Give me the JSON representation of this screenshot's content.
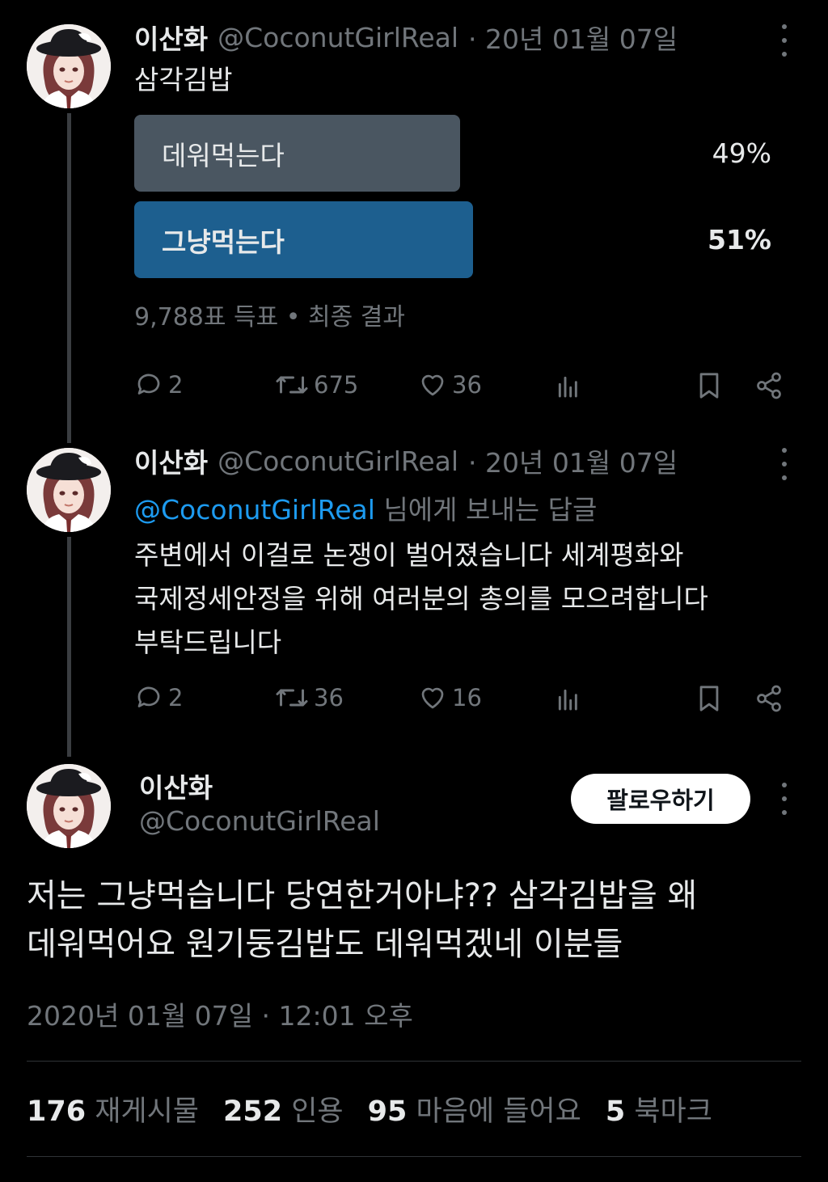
{
  "tweet1": {
    "name": "이산화",
    "handle": "@CoconutGirlReal",
    "date": "· 20년 01월 07일",
    "text": "삼각김밥",
    "poll": [
      {
        "label": "데워먹는다",
        "percent": "49%",
        "fraction": 0.49,
        "winner": false,
        "color": "#4a5661"
      },
      {
        "label": "그냥먹는다",
        "percent": "51%",
        "fraction": 0.51,
        "winner": true,
        "color": "#1d5f8f"
      }
    ],
    "poll_footer": "9,788표 득표 • 최종 결과",
    "actions": {
      "replies": "2",
      "reposts": "675",
      "likes": "36"
    }
  },
  "tweet2": {
    "name": "이산화",
    "handle": "@CoconutGirlReal",
    "date": "· 20년 01월 07일",
    "reply_to_handle": "@CoconutGirlReal",
    "reply_to_suffix": " 님에게 보내는 답글",
    "lines": [
      "주변에서 이걸로 논쟁이 벌어졌습니다 세계평화와",
      "국제정세안정을 위해 여러분의 총의를 모으려합니다",
      "부탁드립니다"
    ],
    "actions": {
      "replies": "2",
      "reposts": "36",
      "likes": "16"
    }
  },
  "main": {
    "name": "이산화",
    "handle": "@CoconutGirlReal",
    "follow_label": "팔로우하기",
    "lines": [
      "저는 그냥먹습니다 당연한거아냐?? 삼각김밥을 왜",
      "데워먹어요 원기둥김밥도 데워먹겠네 이분들"
    ],
    "timestamp": "2020년 01월 07일 · 12:01 오후",
    "stats": [
      {
        "count": "176",
        "label": "재게시물"
      },
      {
        "count": "252",
        "label": "인용"
      },
      {
        "count": "95",
        "label": "마음에 들어요"
      },
      {
        "count": "5",
        "label": "북마크"
      }
    ]
  },
  "colors": {
    "accent": "#1d9bf0",
    "muted": "#71767b",
    "poll_winner": "#1d5f8f",
    "poll_other": "#4a5661"
  },
  "icons": [
    "more-icon",
    "reply-icon",
    "repost-icon",
    "like-icon",
    "views-icon",
    "bookmark-icon",
    "share-icon"
  ]
}
